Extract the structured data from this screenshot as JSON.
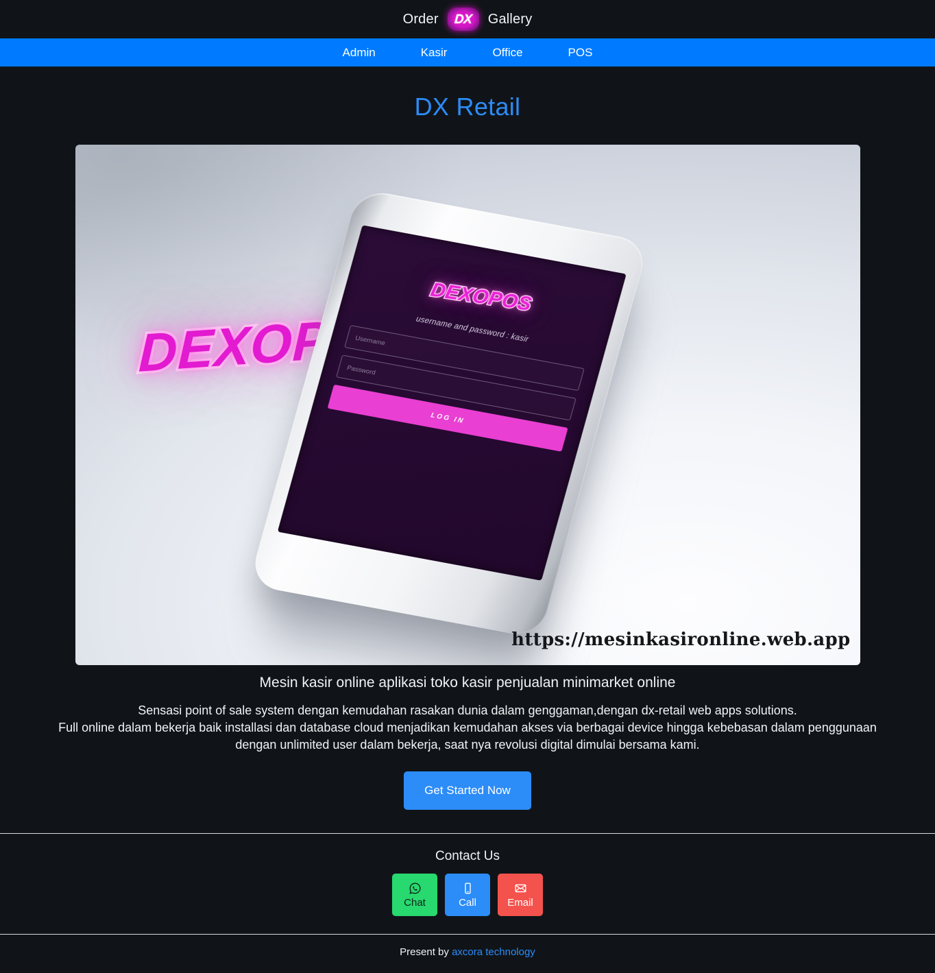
{
  "header": {
    "brand_left": "Order",
    "brand_logo_text": "DX",
    "brand_right": "Gallery",
    "logo_color": "#e80fd0"
  },
  "nav": {
    "accent_color": "#007bff",
    "items": [
      {
        "label": "Admin"
      },
      {
        "label": "Kasir"
      },
      {
        "label": "Office"
      },
      {
        "label": "POS"
      }
    ]
  },
  "main": {
    "page_title": "DX Retail",
    "hero": {
      "wordmark": "DEXOPOS",
      "wordmark_color": "#e21ad0",
      "url_overlay": "https://mesinkasironline.web.app",
      "phone_screen": {
        "logo": "DEXOPOS",
        "hint": "username and password : kasir",
        "username_placeholder": "Username",
        "password_placeholder": "Password",
        "login_button": "LOG IN",
        "screen_bg": "#2a0a35",
        "button_color": "#e93fd2"
      }
    },
    "caption": "Mesin kasir online aplikasi toko kasir penjualan minimarket online",
    "lede_line_1": "Sensasi point of sale system dengan kemudahan rasakan dunia dalam genggaman,dengan dx-retail web apps solutions.",
    "lede_line_2": "Full online dalam bekerja baik installasi dan database cloud menjadikan kemudahan akses via berbagai device hingga kebebasan dalam penggunaan",
    "lede_line_3": "dengan unlimited user dalam bekerja, saat nya revolusi digital dimulai bersama kami.",
    "cta_label": "Get Started Now",
    "cta_color": "#2c8cf8"
  },
  "contact": {
    "title": "Contact Us",
    "buttons": [
      {
        "label": "Chat",
        "icon": "whatsapp-icon",
        "color": "#27d96e"
      },
      {
        "label": "Call",
        "icon": "phone-icon",
        "color": "#2c8cf8"
      },
      {
        "label": "Email",
        "icon": "envelope-icon",
        "color": "#f4524d"
      }
    ]
  },
  "footer": {
    "prefix": "Present by",
    "link_label": "axcora technology",
    "link_color": "#2c8cf8"
  }
}
